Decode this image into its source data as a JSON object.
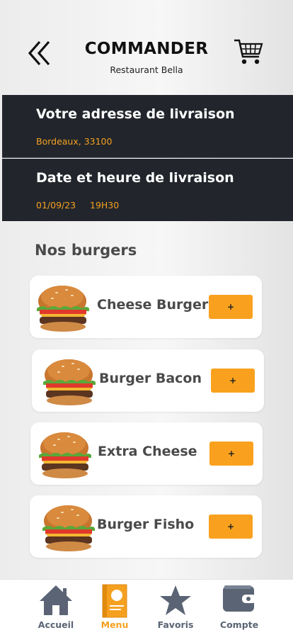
{
  "header": {
    "title": "COMMANDER",
    "subtitle": "Restaurant Bella",
    "back_icon": "double-chevron-left-icon",
    "cart_icon": "shopping-cart-icon"
  },
  "delivery": {
    "address_title": "Votre adresse de livraison",
    "address_value": "Bordeaux, 33100",
    "datetime_title": "Date et heure de livraison",
    "date_value": "01/09/23",
    "time_value": "19H30"
  },
  "menu": {
    "section_title": "Nos burgers",
    "items": [
      {
        "name": "Cheese Burger",
        "add_label": "+"
      },
      {
        "name": "Burger Bacon",
        "add_label": "+"
      },
      {
        "name": "Extra Cheese",
        "add_label": "+"
      },
      {
        "name": "Burger Fisho",
        "add_label": "+"
      }
    ]
  },
  "nav": {
    "items": [
      {
        "label": "Accueil",
        "icon": "home-icon",
        "active": false
      },
      {
        "label": "Menu",
        "icon": "menu-card-icon",
        "active": true
      },
      {
        "label": "Favoris",
        "icon": "star-icon",
        "active": false
      },
      {
        "label": "Compte",
        "icon": "wallet-icon",
        "active": false
      }
    ]
  },
  "colors": {
    "accent": "#f9a11e",
    "dark_panel": "#22262c",
    "nav_icon": "#5a6474"
  }
}
